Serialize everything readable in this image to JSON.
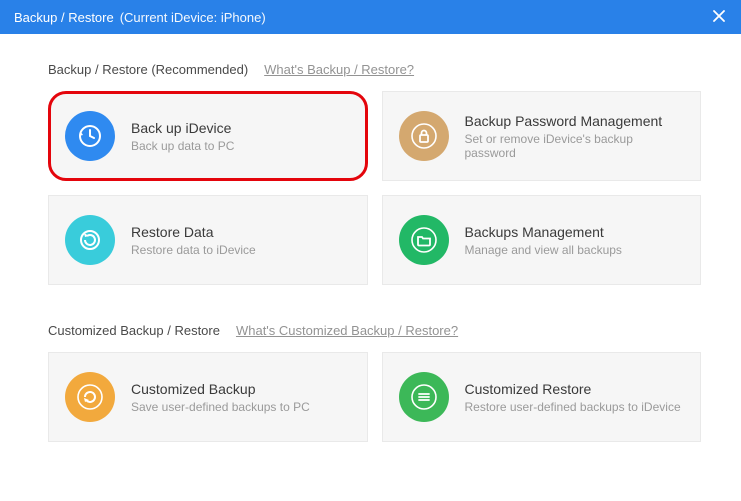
{
  "titlebar": {
    "title": "Backup / Restore",
    "device": "(Current iDevice: iPhone)"
  },
  "sections": {
    "recommended": {
      "label": "Backup / Restore (Recommended)",
      "hint": "What's Backup / Restore?",
      "cards": {
        "backup_idevice": {
          "title": "Back up iDevice",
          "sub": "Back up data to PC",
          "color": "#2f8af0"
        },
        "backup_password": {
          "title": "Backup Password Management",
          "sub": "Set or remove iDevice's backup password",
          "color": "#d4a86f"
        },
        "restore_data": {
          "title": "Restore Data",
          "sub": "Restore data to iDevice",
          "color": "#39ccdb"
        },
        "backups_mgmt": {
          "title": "Backups Management",
          "sub": "Manage and view all backups",
          "color": "#22b866"
        }
      }
    },
    "customized": {
      "label": "Customized Backup / Restore",
      "hint": "What's Customized Backup / Restore?",
      "cards": {
        "custom_backup": {
          "title": "Customized Backup",
          "sub": "Save user-defined backups to PC",
          "color": "#f2a93d"
        },
        "custom_restore": {
          "title": "Customized Restore",
          "sub": "Restore user-defined backups to iDevice",
          "color": "#3cb858"
        }
      }
    }
  }
}
